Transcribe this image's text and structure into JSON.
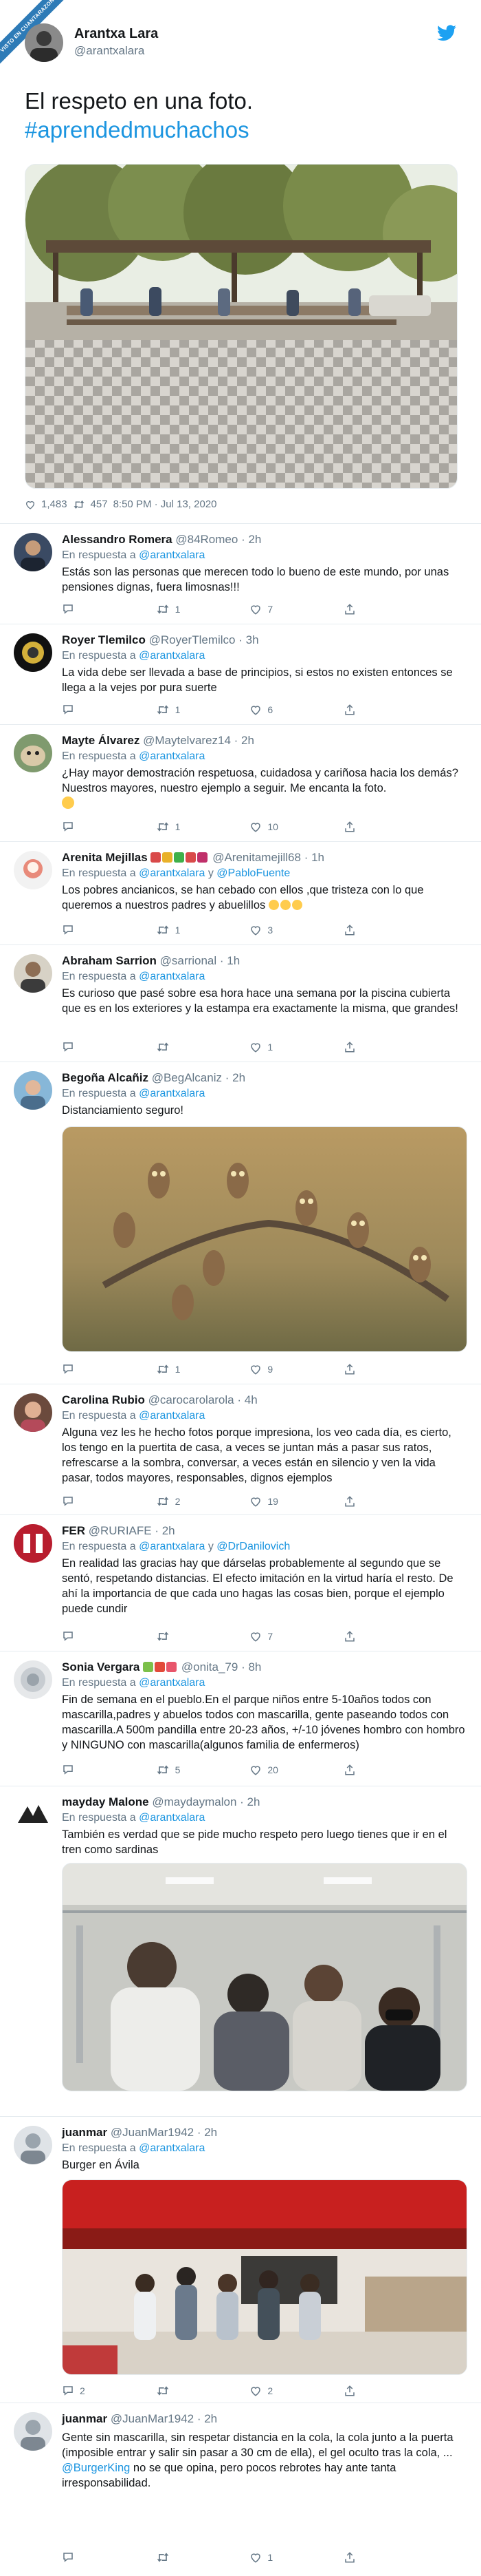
{
  "badge": {
    "text": "VISTO EN CUANTARAZON"
  },
  "tweet": {
    "name": "Arantxa Lara",
    "handle": "@arantxalara",
    "text": "El respeto en una foto.",
    "hashtag": "#aprendedmuchachos",
    "likes": "1,483",
    "retweets": "457",
    "time": "8:50 PM · Jul 13, 2020"
  },
  "replies": [
    {
      "name": "Alessandro Romera",
      "handle": "@84Romeo",
      "time": "· 2h",
      "reply_label": "En respuesta a",
      "reply_to": "@arantxalara",
      "text": "Estás son las personas que merecen todo lo bueno de este mundo, por unas pensiones dignas, fuera limosnas!!!",
      "replies": "",
      "retweets": "1",
      "likes": "7"
    },
    {
      "name": "Royer Tlemilco",
      "handle": "@RoyerTlemilco",
      "time": "· 3h",
      "reply_label": "En respuesta a",
      "reply_to": "@arantxalara",
      "text": "La vida debe ser llevada a base de principios, si estos no existen entonces se llega a la vejes por pura suerte",
      "replies": "",
      "retweets": "1",
      "likes": "6"
    },
    {
      "name": "Mayte Álvarez",
      "handle": "@Maytelvarez14",
      "time": "· 2h",
      "reply_label": "En respuesta a",
      "reply_to": "@arantxalara",
      "text": "¿Hay mayor demostración respetuosa, cuidadosa y cariñosa hacia los demás? Nuestros mayores, nuestro ejemplo a seguir. Me encanta la foto.",
      "replies": "",
      "retweets": "1",
      "likes": "10"
    },
    {
      "name": "Arenita Mejillas",
      "handle": "@Arenitamejill68",
      "time": "· 1h",
      "reply_label": "En respuesta a",
      "reply_to": "@arantxalara",
      "reply_to_and": "y",
      "reply_to_2": "@PabloFuente",
      "text": "Los pobres ancianicos, se han cebado con ellos ,que tristeza con lo que queremos a nuestros padres y abuelillos",
      "replies": "",
      "retweets": "1",
      "likes": "3"
    },
    {
      "name": "Abraham Sarrion",
      "handle": "@sarrional",
      "time": "· 1h",
      "reply_label": "En respuesta a",
      "reply_to": "@arantxalara",
      "text": "Es curioso que pasé sobre esa hora hace una semana por la piscina cubierta que es en los exteriores y la estampa era exactamente la misma, que grandes!",
      "replies": "",
      "retweets": "",
      "likes": "1"
    },
    {
      "name": "Begoña Alcañiz",
      "handle": "@BegAlcaniz",
      "time": "· 2h",
      "reply_label": "En respuesta a",
      "reply_to": "@arantxalara",
      "text": "Distanciamiento seguro!",
      "replies": "",
      "retweets": "1",
      "likes": "9"
    },
    {
      "name": "Carolina Rubio",
      "handle": "@carocarolarola",
      "time": "· 4h",
      "reply_label": "En respuesta a",
      "reply_to": "@arantxalara",
      "text": "Alguna vez les he hecho fotos porque impresiona, los veo cada día, es cierto, los tengo en la puertita de casa, a veces se juntan más a pasar sus ratos, refrescarse a la sombra, conversar, a veces están en silencio y ven la vida pasar, todos mayores, responsables, dignos ejemplos",
      "replies": "",
      "retweets": "2",
      "likes": "19"
    },
    {
      "name": "FER",
      "handle": "@RURIAFE",
      "time": "· 2h",
      "reply_label": "En respuesta a",
      "reply_to": "@arantxalara",
      "reply_to_and": "y",
      "reply_to_2": "@DrDanilovich",
      "text": "En realidad las gracias hay que dárselas probablemente al segundo que se sentó, respetando distancias. El efecto imitación en la virtud haría el resto. De ahí la importancia de que cada uno hagas las cosas bien, porque el ejemplo puede cundir",
      "replies": "",
      "retweets": "",
      "likes": "7"
    },
    {
      "name": "Sonia Vergara",
      "handle": "@onita_79",
      "time": "· 8h",
      "reply_label": "En respuesta a",
      "reply_to": "@arantxalara",
      "text": "Fin de semana en el pueblo.En el parque niños entre 5-10años todos con mascarilla,padres y abuelos todos con mascarilla, gente paseando todos con mascarilla.A 500m pandilla entre 20-23 años, +/-10 jóvenes hombro con hombro y NINGUNO con mascarilla(algunos familia de enfermeros)",
      "replies": "",
      "retweets": "5",
      "likes": "20"
    },
    {
      "name": "mayday Malone",
      "handle": "@maydaymalon",
      "time": "· 2h",
      "reply_label": "En respuesta a",
      "reply_to": "@arantxalara",
      "text": "También es verdad que se pide mucho respeto pero luego tienes que ir en el tren como sardinas",
      "replies": "",
      "retweets": "",
      "likes": ""
    },
    {
      "name": "juanmar",
      "handle": "@JuanMar1942",
      "time": "· 2h",
      "reply_label": "En respuesta a",
      "reply_to": "@arantxalara",
      "text": "Burger en Ávila",
      "replies": "2",
      "retweets": "",
      "likes": "2"
    },
    {
      "name": "juanmar",
      "handle": "@JuanMar1942",
      "time": "· 2h",
      "reply_label": "",
      "reply_to": "",
      "text": "Gente sin mascarilla, sin respetar distancia en la cola, la cola junto a la puerta (imposible entrar y salir sin pasar a 30 cm de ella), el gel oculto tras la cola, ...",
      "text_mention": "@BurgerKing",
      "text_2": "no se que opina, pero pocos rebrotes hay ante tanta irresponsabilidad.",
      "replies": "",
      "retweets": "",
      "likes": "1"
    }
  ]
}
